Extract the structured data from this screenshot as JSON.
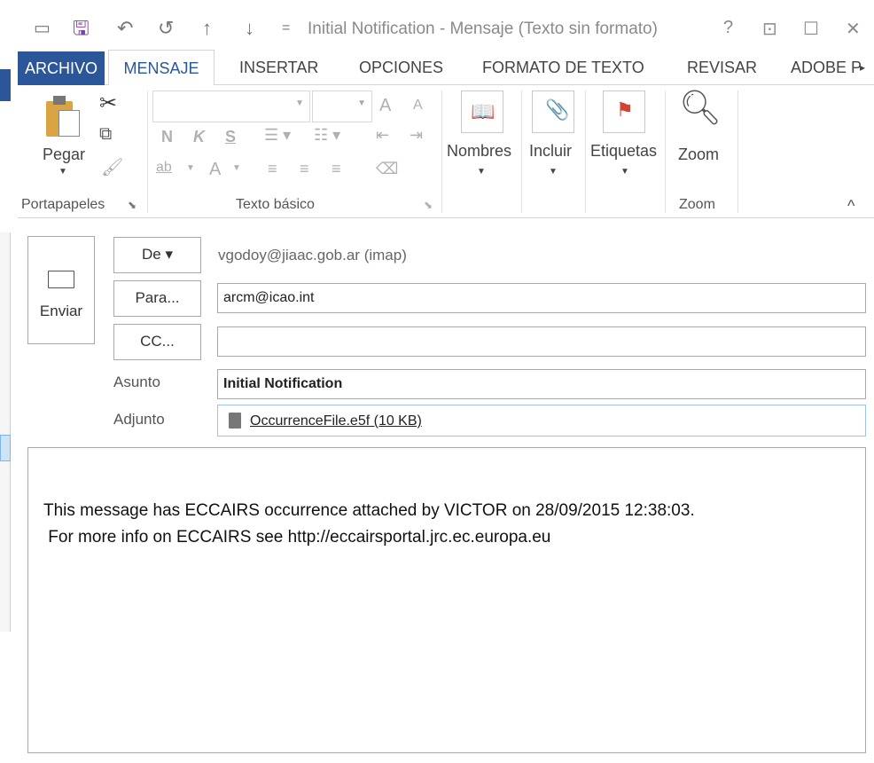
{
  "window": {
    "title": "Initial Notification - Mensaje (Texto sin formato)",
    "help": "?",
    "ribbon_display": "⊡",
    "maximize": "☐",
    "close": "✕"
  },
  "quick_access": {
    "undo": "↶",
    "redo": "↺",
    "up": "↑",
    "down": "↓",
    "customize": "="
  },
  "tabs": [
    {
      "label": "ARCHIVO"
    },
    {
      "label": "MENSAJE"
    },
    {
      "label": "INSERTAR"
    },
    {
      "label": "OPCIONES"
    },
    {
      "label": "FORMATO DE TEXTO"
    },
    {
      "label": "REVISAR"
    },
    {
      "label": "ADOBE P"
    }
  ],
  "ribbon": {
    "paste_label": "Pegar",
    "clipboard_group": "Portapapeles",
    "basic_text_group": "Texto básico",
    "bold": "N",
    "italic": "K",
    "underline": "S",
    "grow_font": "A",
    "shrink_font": "A",
    "font_color": "A",
    "highlight": "ab",
    "names_label": "Nombres",
    "include_label": "Incluir",
    "tags_label": "Etiquetas",
    "zoom_label": "Zoom",
    "zoom_group": "Zoom",
    "collapse": "^"
  },
  "compose": {
    "send_label": "Enviar",
    "from_button": "De ▾",
    "from_value": "vgodoy@jiaac.gob.ar (imap)",
    "to_button": "Para...",
    "to_value": "arcm@icao.int",
    "cc_button": "CC...",
    "cc_value": "",
    "subject_label": "Asunto",
    "subject_value": "Initial Notification",
    "attach_label": "Adjunto",
    "attach_value": "OccurrenceFile.e5f (10 KB)"
  },
  "body": {
    "line1": "This message has ECCAIRS occurrence attached by VICTOR on 28/09/2015 12:38:03.",
    "line2": " For more info on ECCAIRS see http://eccairsportal.jrc.ec.europa.eu"
  },
  "colors": {
    "file_tab": "#2b579a",
    "accent": "#2b579a",
    "save_icon": "#7b3fa0"
  }
}
